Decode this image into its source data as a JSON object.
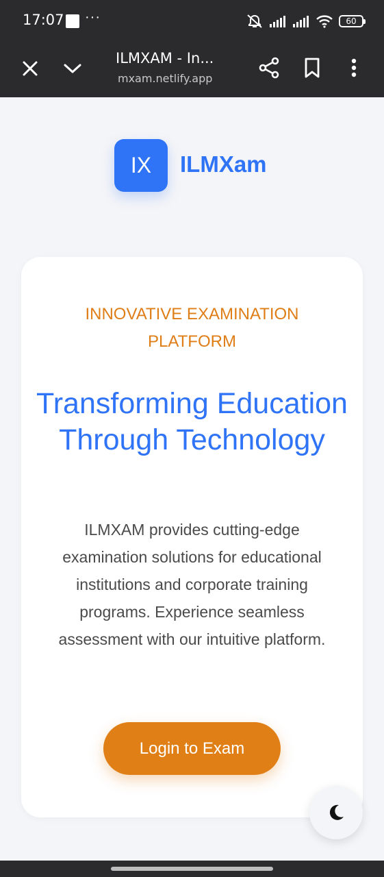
{
  "status_bar": {
    "time": "17:07",
    "dots": "···",
    "battery": "60"
  },
  "browser": {
    "title": "ILMXAM - In...",
    "url": "mxam.netlify.app",
    "icons": [
      "close-icon",
      "chevron-down-icon",
      "share-icon",
      "bookmark-icon",
      "more-vert-icon"
    ]
  },
  "brand": {
    "logo_initials": "IX",
    "name": "ILMXam"
  },
  "hero": {
    "tagline": "INNOVATIVE EXAMINATION PLATFORM",
    "headline": "Transforming Education Through Technology",
    "description": "ILMXAM provides cutting-edge examination solutions for educational institutions and corporate training programs. Experience seamless assessment with our intuitive platform.",
    "cta_label": "Login to Exam"
  },
  "theme_toggle": {
    "icon": "moon-icon"
  },
  "colors": {
    "primary_blue": "#2f73f6",
    "accent_orange": "#e07f16",
    "toolbar_dark": "#2b2b2d",
    "page_bg": "#f4f5f8"
  }
}
